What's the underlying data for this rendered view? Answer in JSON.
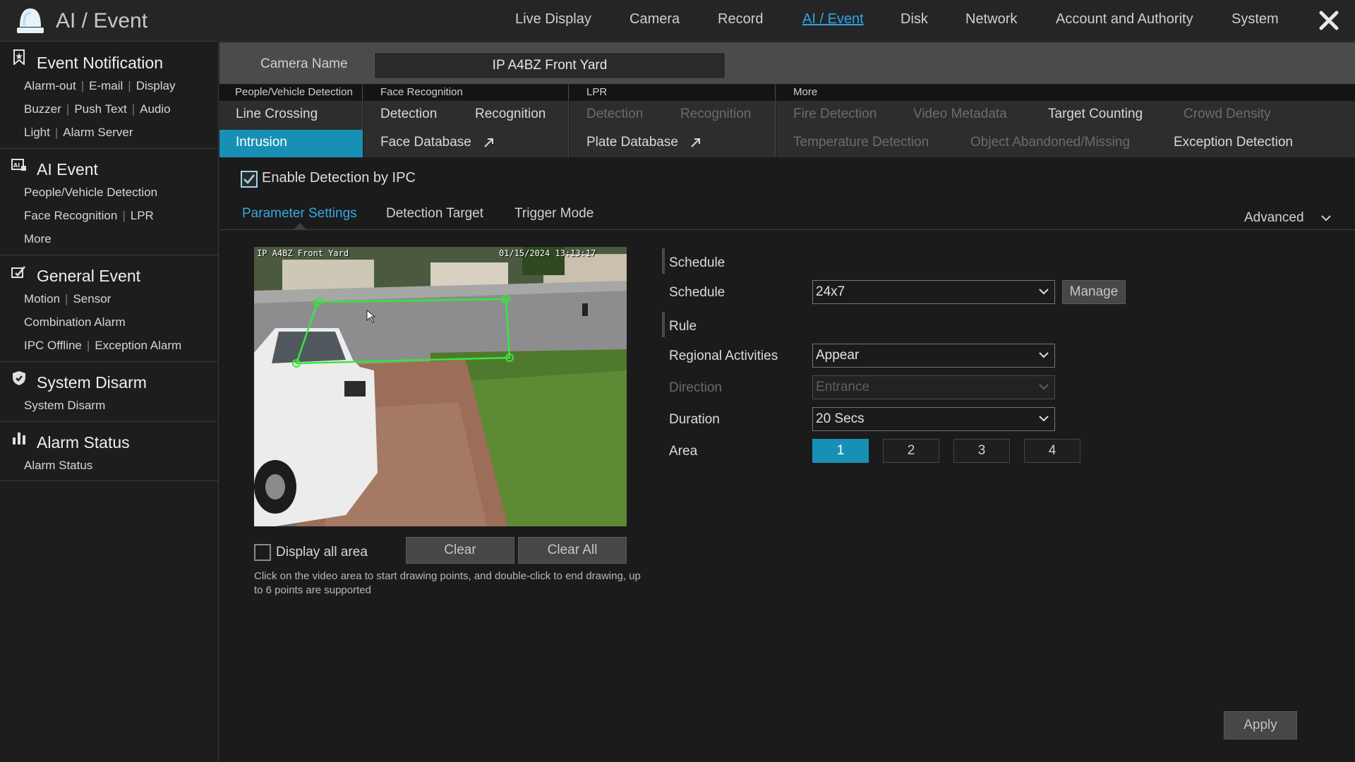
{
  "header": {
    "title": "AI / Event",
    "nav": [
      "Live Display",
      "Camera",
      "Record",
      "AI / Event",
      "Disk",
      "Network",
      "Account and Authority",
      "System"
    ],
    "active_nav": "AI / Event"
  },
  "sidebar": {
    "groups": [
      {
        "title": "Event Notification",
        "icon": "bookmark-icon",
        "rows": [
          [
            "Alarm-out",
            "E-mail",
            "Display"
          ],
          [
            "Buzzer",
            "Push Text",
            "Audio"
          ],
          [
            "Light",
            "Alarm Server"
          ]
        ]
      },
      {
        "title": "AI Event",
        "icon": "ai-icon",
        "rows": [
          [
            "People/Vehicle Detection"
          ],
          [
            "Face Recognition",
            "LPR"
          ],
          [
            "More"
          ]
        ]
      },
      {
        "title": "General Event",
        "icon": "general-event-icon",
        "rows": [
          [
            "Motion",
            "Sensor"
          ],
          [
            "Combination Alarm"
          ],
          [
            "IPC Offline",
            "Exception Alarm"
          ]
        ]
      },
      {
        "title": "System Disarm",
        "icon": "shield-icon",
        "rows": [
          [
            "System Disarm"
          ]
        ]
      },
      {
        "title": "Alarm Status",
        "icon": "bar-chart-icon",
        "rows": [
          [
            "Alarm Status"
          ]
        ]
      }
    ]
  },
  "camera": {
    "label": "Camera Name",
    "value": "IP A4BZ Front Yard"
  },
  "categories": {
    "people_vehicle": {
      "title": "People/Vehicle Detection",
      "items": [
        "Line Crossing",
        "Intrusion"
      ],
      "active": "Intrusion"
    },
    "face": {
      "title": "Face Recognition",
      "items": [
        "Detection",
        "Recognition",
        "Face Database"
      ]
    },
    "lpr": {
      "title": "LPR",
      "items": [
        "Detection",
        "Recognition",
        "Plate Database"
      ]
    },
    "more": {
      "title": "More",
      "items": [
        "Fire Detection",
        "Video Metadata",
        "Target Counting",
        "Crowd Density",
        "Temperature Detection",
        "Object Abandoned/Missing",
        "Exception Detection"
      ]
    }
  },
  "enable_detection": {
    "label": "Enable Detection by IPC",
    "checked": true
  },
  "tabs": {
    "items": [
      "Parameter Settings",
      "Detection Target",
      "Trigger Mode"
    ],
    "active": "Parameter Settings",
    "advanced": "Advanced"
  },
  "video": {
    "osd_name": "IP A4BZ Front Yard",
    "osd_time": "01/15/2024 13:13:17",
    "display_all_label": "Display all area",
    "display_all_checked": false,
    "clear": "Clear",
    "clear_all": "Clear All",
    "hint": "Click on the video area to start drawing points, and double-click to end drawing, up to 6 points are supported"
  },
  "settings": {
    "schedule_section": "Schedule",
    "schedule_label": "Schedule",
    "schedule_value": "24x7",
    "manage": "Manage",
    "rule_section": "Rule",
    "regional_label": "Regional Activities",
    "regional_value": "Appear",
    "direction_label": "Direction",
    "direction_value": "Entrance",
    "duration_label": "Duration",
    "duration_value": "20 Secs",
    "area_label": "Area",
    "areas": [
      "1",
      "2",
      "3",
      "4"
    ],
    "active_area": "1"
  },
  "apply": "Apply",
  "colors": {
    "accent": "#1890b6",
    "link": "#35a9e0",
    "zone": "#39e639"
  }
}
